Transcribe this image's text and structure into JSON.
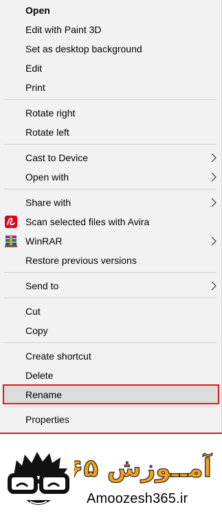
{
  "menu": {
    "items": [
      {
        "label": "Open",
        "bold": true
      },
      {
        "label": "Edit with Paint 3D"
      },
      {
        "label": "Set as desktop background"
      },
      {
        "label": "Edit"
      },
      {
        "label": "Print"
      },
      {
        "label": "Rotate right"
      },
      {
        "label": "Rotate left"
      },
      {
        "label": "Cast to Device",
        "submenu": true
      },
      {
        "label": "Open with",
        "submenu": true
      },
      {
        "label": "Share with",
        "submenu": true
      },
      {
        "label": "Scan selected files with Avira",
        "icon": "avira-icon"
      },
      {
        "label": "WinRAR",
        "icon": "winrar-icon",
        "submenu": true
      },
      {
        "label": "Restore previous versions"
      },
      {
        "label": "Send to",
        "submenu": true
      },
      {
        "label": "Cut"
      },
      {
        "label": "Copy"
      },
      {
        "label": "Create shortcut"
      },
      {
        "label": "Delete"
      },
      {
        "label": "Rename",
        "highlighted": true
      },
      {
        "label": "Properties"
      }
    ],
    "highlight_color": "#e0161d"
  },
  "branding": {
    "persian_name": "آمــوزش ۳۶۵",
    "site": "Amoozesh365.ir",
    "accent_color": "#f4a21d"
  }
}
